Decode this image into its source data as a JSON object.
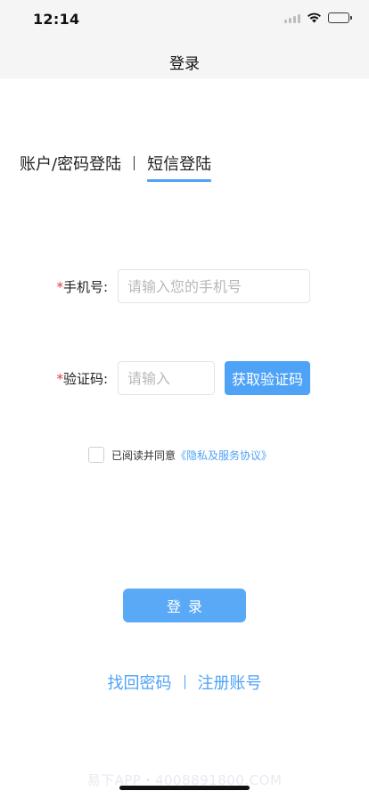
{
  "status_bar": {
    "time": "12:14",
    "icons": [
      "signal-icon",
      "wifi-icon",
      "battery-charging-icon"
    ],
    "battery_color": "#4cd964"
  },
  "nav": {
    "title": "登录"
  },
  "tabs": [
    {
      "label": "账户/密码登陆",
      "active": false
    },
    {
      "label": "短信登陆",
      "active": true
    }
  ],
  "form": {
    "phone": {
      "required_mark": "*",
      "label": "手机号:",
      "placeholder": "请输入您的手机号",
      "value": ""
    },
    "code": {
      "required_mark": "*",
      "label": "验证码:",
      "placeholder": "请输入",
      "value": ""
    },
    "get_code_label": "获取验证码"
  },
  "agreement": {
    "checked": false,
    "text": "已阅读并同意",
    "link": "《隐私及服务协议》"
  },
  "login_label": "登录",
  "bottom_links": {
    "forgot": "找回密码",
    "register": "注册账号"
  },
  "watermark": "易下APP・4008891800.COM",
  "colors": {
    "accent": "#4fa3f7",
    "required": "#e53935",
    "header_bg": "#f5f5f5"
  }
}
